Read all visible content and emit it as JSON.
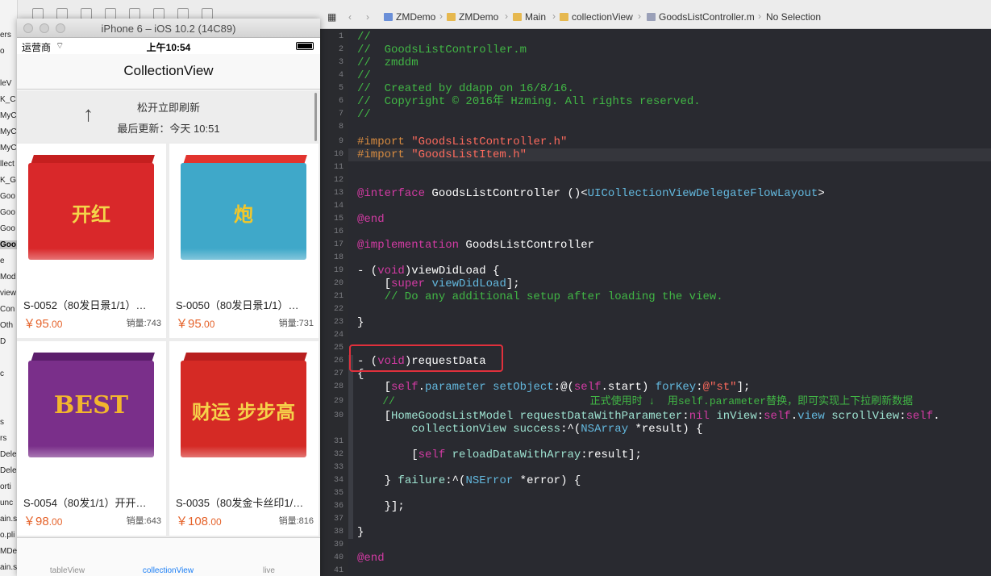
{
  "navigator": {
    "items": [
      "ers",
      "o",
      "",
      "leV",
      "K_C",
      "MyC",
      "MyC",
      "MyC",
      "llect",
      "K_G",
      "Goo",
      "Goo",
      "Goo",
      "Goo",
      "e",
      "Mod",
      "view",
      "Con",
      "Oth",
      "D",
      "",
      "c",
      "",
      "",
      "s",
      "rs",
      "Deleg",
      "Deleg",
      "orti",
      "unc",
      "ain.s",
      "o.pli",
      "MDen",
      "ain.s"
    ]
  },
  "simulator": {
    "window_title": "iPhone 6 – iOS 10.2 (14C89)",
    "status": {
      "carrier": "运营商",
      "wifi_icon": "wifi-icon",
      "time": "上午10:54"
    },
    "nav_title": "CollectionView",
    "refresh": {
      "arrow": "↑",
      "line1": "松开立即刷新",
      "line2": "最后更新：今天 10:51"
    },
    "products": [
      {
        "name": "S-0052（80发日景1/1）…",
        "price_int": "￥95",
        "price_dec": ".00",
        "sales": "销量:743",
        "box_color": "#d9282a",
        "top_color": "#c51f1f",
        "label": "开红",
        "label_color": "#f4d54a"
      },
      {
        "name": "S-0050（80发日景1/1）…",
        "price_int": "￥95",
        "price_dec": ".00",
        "sales": "销量:731",
        "box_color": "#3fa8c9",
        "top_color": "#e2342e",
        "label": "炮",
        "label_color": "#f2c72a"
      },
      {
        "name": "S-0054（80发1/1）开开…",
        "price_int": "￥98",
        "price_dec": ".00",
        "sales": "销量:643",
        "box_color": "#7a2f8a",
        "top_color": "#5b1e6b",
        "label": "BEST",
        "label_color": "#f2b62d"
      },
      {
        "name": "S-0035（80发金卡丝印1/…",
        "price_int": "￥108",
        "price_dec": ".00",
        "sales": "销量:816",
        "box_color": "#d52a25",
        "top_color": "#b81f1f",
        "label": "财运 步步高",
        "label_color": "#f6d24a"
      }
    ],
    "tabs": [
      {
        "label": "tableView",
        "active": false
      },
      {
        "label": "collectionView",
        "active": true
      },
      {
        "label": "live",
        "active": false
      }
    ]
  },
  "jumpbar": {
    "items": [
      "ZMDemo",
      "ZMDemo",
      "Main",
      "collectionView",
      "GoodsListController.m",
      "No Selection"
    ]
  },
  "editor": {
    "line_numbers": [
      "1",
      "2",
      "3",
      "4",
      "5",
      "6",
      "7",
      "8",
      "9",
      "10",
      "11",
      "12",
      "13",
      "14",
      "15",
      "16",
      "17",
      "18",
      "19",
      "20",
      "21",
      "22",
      "23",
      "24",
      "25",
      "26",
      "27",
      "28",
      "29",
      "30",
      "",
      "31",
      "32",
      "33",
      "34",
      "35",
      "36",
      "37",
      "38",
      "39",
      "40",
      "41"
    ],
    "lines": {
      "l1": "//",
      "l2": "//  GoodsListController.m",
      "l3": "//  zmddm",
      "l4": "//",
      "l5": "//  Created by ddapp on 16/8/16.",
      "l6": "//  Copyright © 2016年 Hzming. All rights reserved.",
      "l7": "//",
      "l9a": "#import ",
      "l9b": "\"GoodsListController.h\"",
      "l10a": "#import ",
      "l10b": "\"GoodsListItem.h\"",
      "l13a": "@interface",
      "l13b": " GoodsListController ()<",
      "l13c": "UICollectionViewDelegateFlowLayout",
      "l13d": ">",
      "l15": "@end",
      "l17a": "@implementation",
      "l17b": " GoodsListController",
      "l19a": "- (",
      "l19b": "void",
      "l19c": ")viewDidLoad {",
      "l20a": "    [",
      "l20b": "super",
      "l20c": " ",
      "l20d": "viewDidLoad",
      "l20e": "];",
      "l21": "    // Do any additional setup after loading the view.",
      "l23": "}",
      "l26a": "- (",
      "l26b": "void",
      "l26c": ")requestData",
      "l27": "{",
      "l28a": "    [",
      "l28b": "self",
      "l28c": ".",
      "l28d": "parameter",
      "l28e": " ",
      "l28f": "setObject",
      "l28g": ":@(",
      "l28h": "self",
      "l28i": ".",
      "l28j": "start",
      "l28k": ") ",
      "l28l": "forKey",
      "l28m": ":",
      "l28n": "@\"st\"",
      "l28o": "];",
      "l29": "    //                               正式使用时 ↓  用self.parameter替换，即可实现上下拉刷新数据",
      "l30a": "    [",
      "l30b": "HomeGoodsListModel",
      "l30c": " ",
      "l30d": "requestDataWithParameter",
      "l30e": ":",
      "l30f": "nil",
      "l30g": " ",
      "l30h": "inView",
      "l30i": ":",
      "l30j": "self",
      "l30k": ".",
      "l30l": "view",
      "l30m": " ",
      "l30n": "scrollView",
      "l30o": ":",
      "l30p": "self",
      "l30q": ".",
      "l30w1": "        ",
      "l30w2": "collectionView",
      "l30w3": " ",
      "l30w4": "success",
      "l30w5": ":^(",
      "l30w6": "NSArray",
      "l30w7": " *result) {",
      "l32a": "        [",
      "l32b": "self",
      "l32c": " ",
      "l32d": "reloadDataWithArray",
      "l32e": ":result];",
      "l34a": "    } ",
      "l34b": "failure",
      "l34c": ":^(",
      "l34d": "NSError",
      "l34e": " *error) {",
      "l36": "    }];",
      "l38": "}",
      "l40": "@end"
    }
  },
  "colors": {
    "comment": "#41b645",
    "keyword": "#d23ba3",
    "string": "#fc6a5d",
    "highlight_box": "#e0303c",
    "price": "#e5632b",
    "tab_active": "#1a7ef5"
  }
}
